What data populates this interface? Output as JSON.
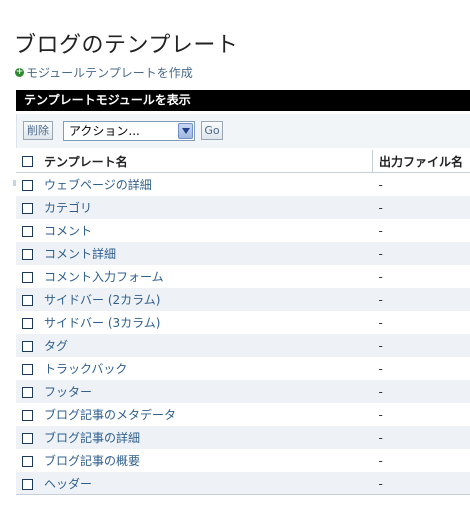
{
  "page": {
    "title": "ブログのテンプレート",
    "create_link": "モジュールテンプレートを作成"
  },
  "table_header": "テンプレートモジュールを表示",
  "actions": {
    "delete_label": "削除",
    "select_value": "アクション...",
    "go_label": "Go"
  },
  "columns": {
    "name": "テンプレート名",
    "file": "出力ファイル名"
  },
  "rows": [
    {
      "name": "ウェブページの詳細",
      "file": "-"
    },
    {
      "name": "カテゴリ",
      "file": "-"
    },
    {
      "name": "コメント",
      "file": "-"
    },
    {
      "name": "コメント詳細",
      "file": "-"
    },
    {
      "name": "コメント入力フォーム",
      "file": "-"
    },
    {
      "name": "サイドバー (2カラム)",
      "file": "-"
    },
    {
      "name": "サイドバー (3カラム)",
      "file": "-"
    },
    {
      "name": "タグ",
      "file": "-"
    },
    {
      "name": "トラックバック",
      "file": "-"
    },
    {
      "name": "フッター",
      "file": "-"
    },
    {
      "name": "ブログ記事のメタデータ",
      "file": "-"
    },
    {
      "name": "ブログ記事の詳細",
      "file": "-"
    },
    {
      "name": "ブログ記事の概要",
      "file": "-"
    },
    {
      "name": "ヘッダー",
      "file": "-"
    }
  ]
}
